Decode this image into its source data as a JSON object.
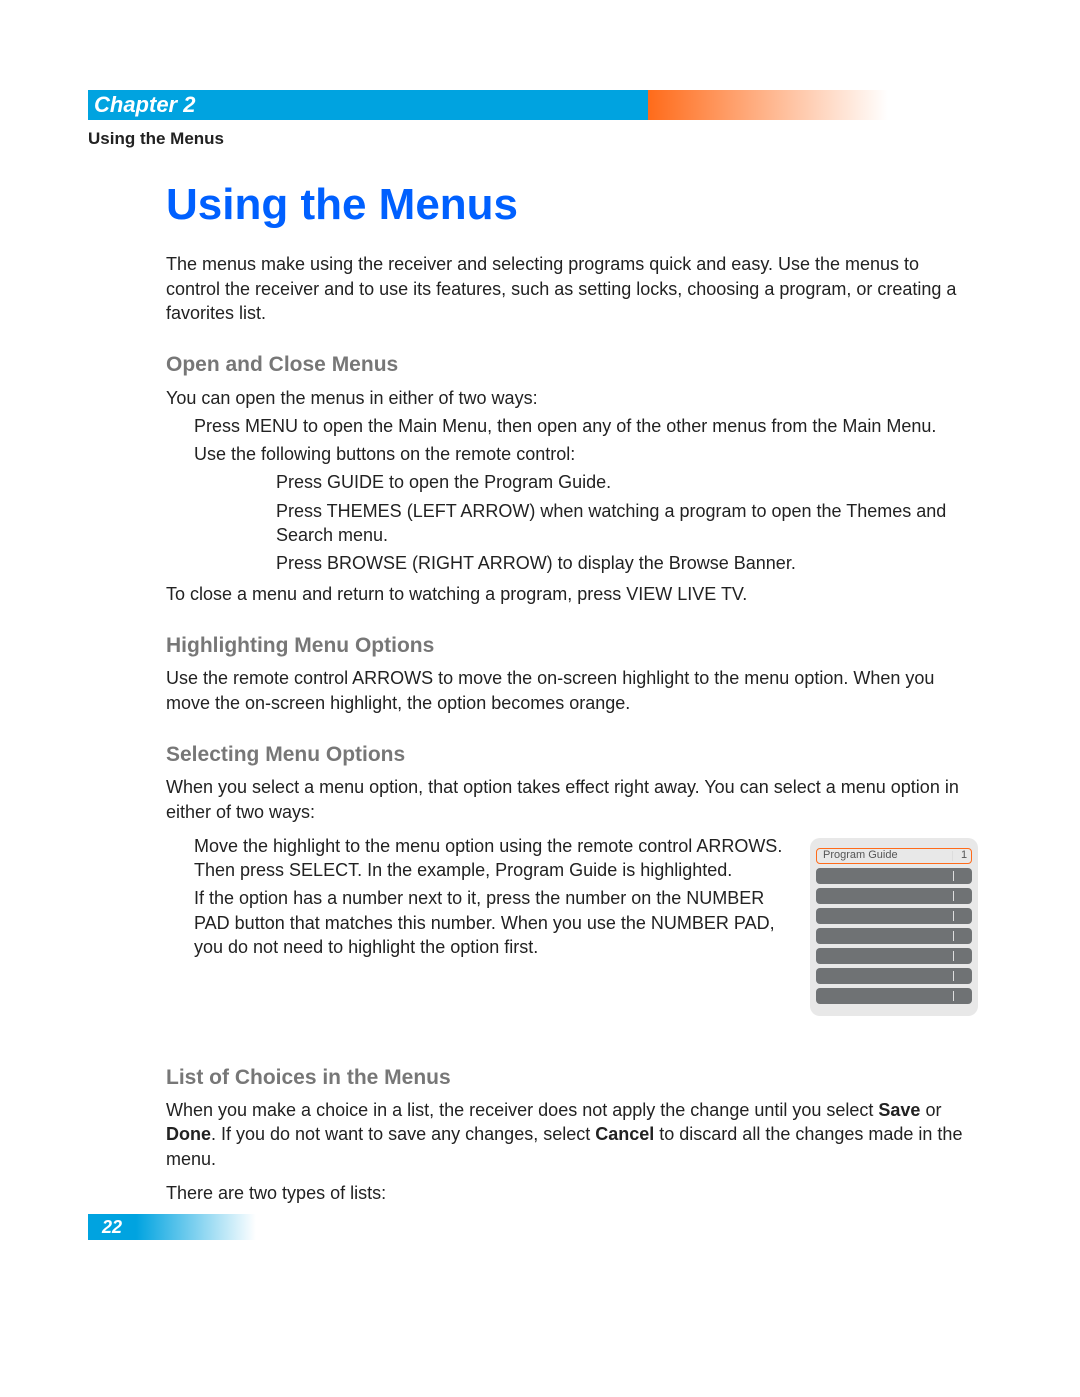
{
  "chapter_label": "Chapter 2",
  "section_label": "Using the Menus",
  "page_title": "Using the Menus",
  "intro": "The menus make using the receiver and selecting programs quick and easy. Use the menus to control the receiver and to use its features, such as setting locks, choosing a program, or creating a favorites list.",
  "open_close": {
    "heading": "Open and Close Menus",
    "lead": "You can open the menus in either of two ways:",
    "ways": [
      "Press MENU to open the Main Menu, then open any of the other menus from the Main Menu.",
      "Use the following buttons on the remote control:"
    ],
    "buttons": [
      "Press GUIDE to open the Program Guide.",
      "Press THEMES (LEFT ARROW) when watching a program to open the Themes and Search menu.",
      "Press BROWSE (RIGHT ARROW) to display the Browse Banner."
    ],
    "close": "To close a menu and return to watching a program, press VIEW LIVE TV."
  },
  "highlighting": {
    "heading": "Highlighting Menu Options",
    "body": "Use the remote control ARROWS to move the on-screen highlight to the menu option. When you move the on-screen highlight, the option becomes orange."
  },
  "selecting": {
    "heading": "Selecting Menu Options",
    "lead": "When you select a menu option, that option takes effect right away. You can select a menu option in either of two ways:",
    "ways": [
      "Move the highlight to the menu option using the remote control ARROWS. Then press SELECT. In the example, Program Guide is highlighted.",
      "If the option has a number next to it, press the number on the NUMBER PAD button that matches this number. When you use the NUMBER PAD, you do not need to highlight the option first."
    ]
  },
  "program_guide": {
    "highlight_label": "Program Guide",
    "highlight_number": "1",
    "blank_rows": 7
  },
  "list_choices": {
    "heading": "List of Choices in the Menus",
    "body_parts": [
      "When you make a choice in a list, the receiver does not apply the change until you select ",
      "Save",
      " or ",
      "Done",
      ". If you do not want to save any changes, select ",
      "Cancel",
      " to discard all the changes made in the menu."
    ],
    "tail": "There are two types of lists:"
  },
  "page_number": "22"
}
